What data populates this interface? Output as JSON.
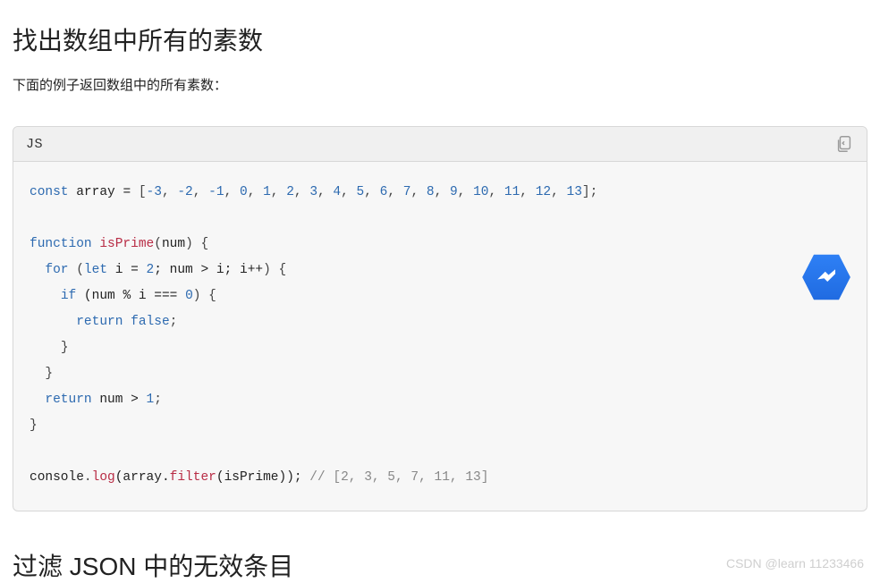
{
  "heading1": "找出数组中所有的素数",
  "intro": "下面的例子返回数组中的所有素数：",
  "code": {
    "lang_label": "JS",
    "line1_kw": "const",
    "line1_var": " array ",
    "line1_eq": "=",
    "line1_open": " [",
    "arr": [
      "-3",
      "-2",
      "-1",
      "0",
      "1",
      "2",
      "3",
      "4",
      "5",
      "6",
      "7",
      "8",
      "9",
      "10",
      "11",
      "12",
      "13"
    ],
    "line1_close": "];",
    "fn_kw": "function",
    "fn_name": "isPrime",
    "fn_params_open": "(",
    "fn_param": "num",
    "fn_params_close": ") {",
    "for_kw": "for",
    "for_open": " (",
    "let_kw": "let",
    "for_init": " i ",
    "for_eq": "=",
    "for_two": "2",
    "for_semi1": "; num ",
    "for_gt": ">",
    "for_cond2": " i; i",
    "for_inc": "++",
    "for_close": ") {",
    "if_kw": "if",
    "if_open": " (num ",
    "mod": "%",
    "if_mid": " i ",
    "eq3": "===",
    "zero": "0",
    "if_close": ") {",
    "ret_kw": "return",
    "false_kw": "false",
    "semic": ";",
    "brace_close": "}",
    "ret2_kw": "return",
    "ret2_expr": " num ",
    "ret2_gt": ">",
    "one": "1",
    "console": "console",
    "dot": ".",
    "log": "log",
    "call_open": "(array.",
    "filter": "filter",
    "call_mid": "(isPrime)); ",
    "comment": "// [2, 3, 5, 7, 11, 13]"
  },
  "heading2": "过滤 JSON 中的无效条目",
  "watermark": "CSDN @learn 11233466",
  "colors": {
    "keyword": "#2d6ab0",
    "function": "#b82c45",
    "comment": "#888888",
    "card_bg": "#f7f7f7",
    "card_border": "#d7d7d7",
    "badge": "#1f6ae0"
  }
}
